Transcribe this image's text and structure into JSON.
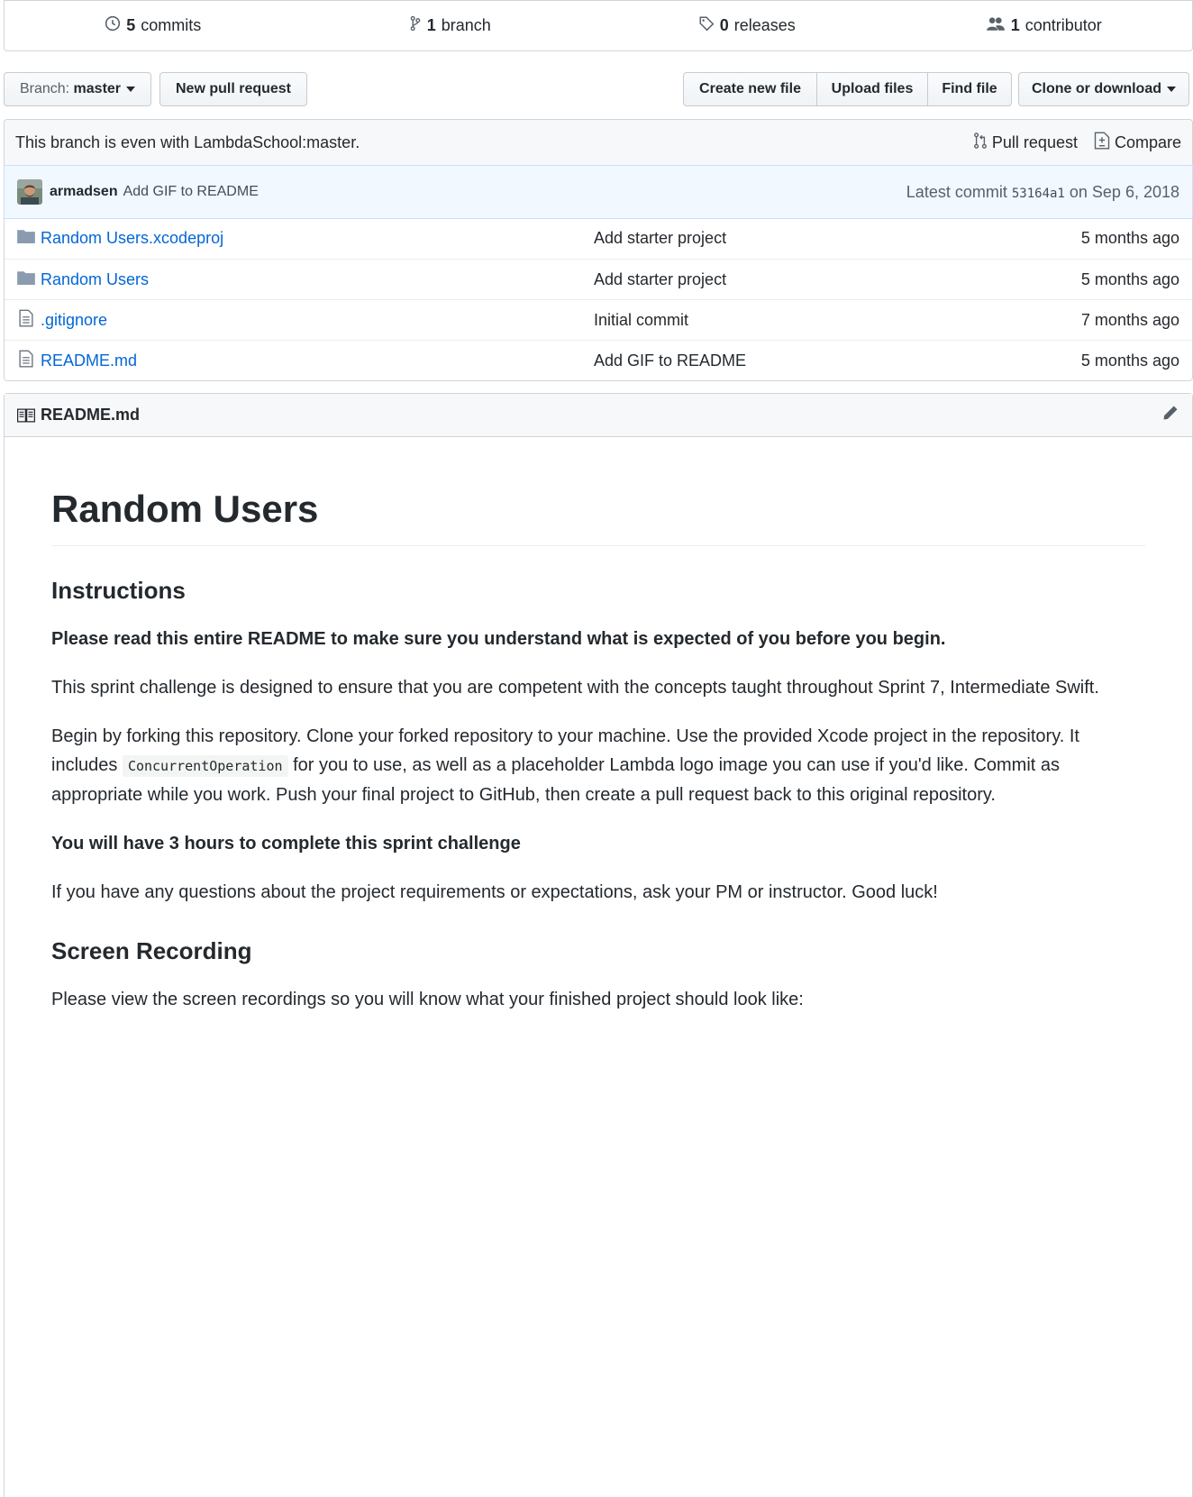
{
  "summary": {
    "commits": {
      "count": "5",
      "label": "commits"
    },
    "branches": {
      "count": "1",
      "label": "branch"
    },
    "releases": {
      "count": "0",
      "label": "releases"
    },
    "contributors": {
      "count": "1",
      "label": "contributor"
    }
  },
  "toolbar": {
    "branch_prefix": "Branch:",
    "branch_name": "master",
    "new_pr": "New pull request",
    "create_file": "Create new file",
    "upload_files": "Upload files",
    "find_file": "Find file",
    "clone": "Clone or download"
  },
  "branch_info": {
    "text": "This branch is even with LambdaSchool:master.",
    "pull_request": "Pull request",
    "compare": "Compare"
  },
  "commit": {
    "author": "armadsen",
    "message": "Add GIF to README",
    "latest_prefix": "Latest commit",
    "sha": "53164a1",
    "date": "on Sep 6, 2018"
  },
  "files": [
    {
      "type": "folder",
      "name": "Random Users.xcodeproj",
      "message": "Add starter project",
      "age": "5 months ago"
    },
    {
      "type": "folder",
      "name": "Random Users",
      "message": "Add starter project",
      "age": "5 months ago"
    },
    {
      "type": "file",
      "name": ".gitignore",
      "message": "Initial commit",
      "age": "7 months ago"
    },
    {
      "type": "file",
      "name": "README.md",
      "message": "Add GIF to README",
      "age": "5 months ago"
    }
  ],
  "readme": {
    "header": "README.md",
    "title": "Random Users",
    "h_instructions": "Instructions",
    "p1": "Please read this entire README to make sure you understand what is expected of you before you begin.",
    "p2": "This sprint challenge is designed to ensure that you are competent with the concepts taught throughout Sprint 7, Intermediate Swift.",
    "p3_a": "Begin by forking this repository. Clone your forked repository to your machine. Use the provided Xcode project in the repository. It includes ",
    "p3_code": "ConcurrentOperation",
    "p3_b": " for you to use, as well as a placeholder Lambda logo image you can use if you'd like. Commit as appropriate while you work. Push your final project to GitHub, then create a pull request back to this original repository.",
    "p4": "You will have 3 hours to complete this sprint challenge",
    "p5": "If you have any questions about the project requirements or expectations, ask your PM or instructor. Good luck!",
    "h_recording": "Screen Recording",
    "p6": "Please view the screen recordings so you will know what your finished project should look like:"
  },
  "colors": {
    "link": "#0366d6",
    "border": "#d1d5da",
    "commit_bg": "#f1f8ff",
    "icon": "#6a737d"
  }
}
